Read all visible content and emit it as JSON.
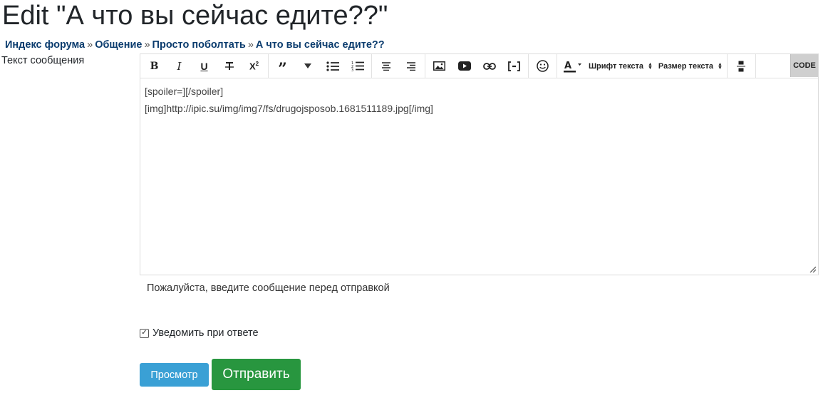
{
  "page": {
    "title": "Edit \"А что вы сейчас едите??\""
  },
  "breadcrumb": {
    "items": [
      "Индекс форума",
      "Общение",
      "Просто поболтать",
      "А что вы сейчас едите??"
    ],
    "separator": "»"
  },
  "form": {
    "message_label": "Текст сообщения",
    "message_value": "[spoiler=][/spoiler]\n[img]http://ipic.su/img/img7/fs/drugojsposob.1681511189.jpg[/img]",
    "hint": "Пожалуйста, введите сообщение перед отправкой",
    "notify_label": "Уведомить при ответе",
    "notify_checked": true,
    "preview_label": "Просмотр",
    "submit_label": "Отправить"
  },
  "toolbar": {
    "font_select": "Шрифт текста",
    "size_select": "Размер текста",
    "code_label": "CODE",
    "icons": [
      "bold-icon",
      "italic-icon",
      "underline-icon",
      "strikethrough-icon",
      "superscript-icon",
      "quote-icon",
      "dropdown-icon",
      "bullet-list-icon",
      "numbered-list-icon",
      "align-center-icon",
      "align-right-icon",
      "image-icon",
      "youtube-icon",
      "link-icon",
      "spoiler-icon",
      "smiley-icon",
      "text-color-icon",
      "horizontal-rule-icon"
    ]
  },
  "colors": {
    "breadcrumb_link": "#0b3c6e",
    "preview_button": "#3aa0d5",
    "submit_button": "#28963f",
    "code_button_bg": "#cfcfcf"
  }
}
